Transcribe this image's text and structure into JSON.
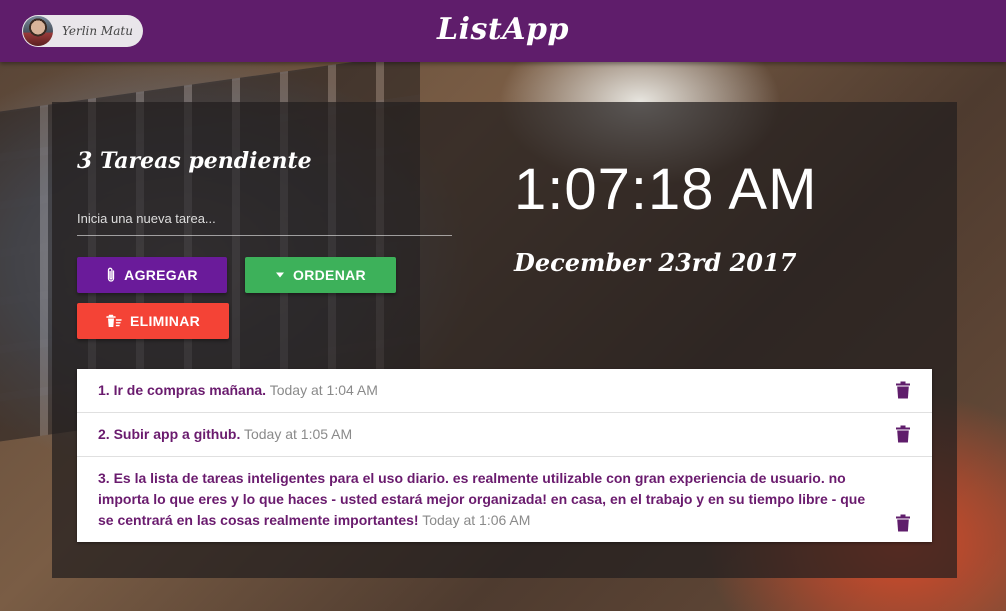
{
  "header": {
    "user_name": "Yerlin Matu",
    "app_title": "ListApp",
    "bar_color": "#5f1d6b"
  },
  "main": {
    "pending_label": "3 Tareas pendiente",
    "new_task_placeholder": "Inicia una nueva tarea...",
    "buttons": {
      "add": "AGREGAR",
      "order": "ORDENAR",
      "delete": "ELIMINAR"
    },
    "clock": "1:07:18 AM",
    "date": "December 23rd 2017"
  },
  "tasks": [
    {
      "text": "1. Ir de compras mañana.",
      "time": "Today at 1:04 AM"
    },
    {
      "text": "2. Subir app a github.",
      "time": "Today at 1:05 AM"
    },
    {
      "text": "3. Es la lista de tareas inteligentes para el uso diario. es realmente utilizable con gran experiencia de usuario. no importa lo que eres y lo que haces - usted estará mejor organizada! en casa, en el trabajo y en su tiempo libre - que se centrará en las cosas realmente importantes!",
      "time": "Today at 1:06 AM"
    }
  ],
  "icons": {
    "add": "paperclip-icon",
    "order": "caret-down-icon",
    "delete": "trash-sweep-icon",
    "task_delete": "trash-icon"
  },
  "colors": {
    "purple": "#6a1b9a",
    "green": "#3db15a",
    "red": "#f44336"
  }
}
